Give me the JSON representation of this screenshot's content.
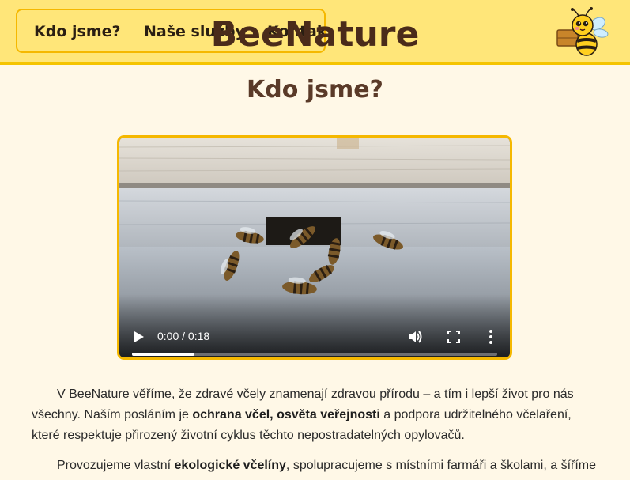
{
  "header": {
    "nav": [
      {
        "label": "Kdo jsme?"
      },
      {
        "label": "Naše služby"
      },
      {
        "label": "Kontakt"
      }
    ],
    "site_title": "BeeNature",
    "mascot_icon": "bee-mascot-icon",
    "colors": {
      "header_bg": "#ffe679",
      "accent": "#f5b800",
      "title": "#4a2b1a"
    }
  },
  "main": {
    "title": "Kdo jsme?",
    "video": {
      "time_label": "0:00 / 0:18",
      "progress": 0.17
    },
    "paragraph1": {
      "t1": "V BeeNature věříme, že zdravé včely znamenají zdravou přírodu – a tím i lepší život pro nás všechny. Naším posláním je ",
      "b1": "ochrana včel, osvěta veřejnosti",
      "t2": " a podpora udržitelného včelaření, které respektuje přirozený životní cyklus těchto nepostradatelných opylovačů."
    },
    "paragraph2": {
      "t1": "Provozujeme vlastní ",
      "b1": "ekologické včelíny",
      "t2": ", spolupracujeme s místními farmáři a školami, a šíříme"
    }
  }
}
